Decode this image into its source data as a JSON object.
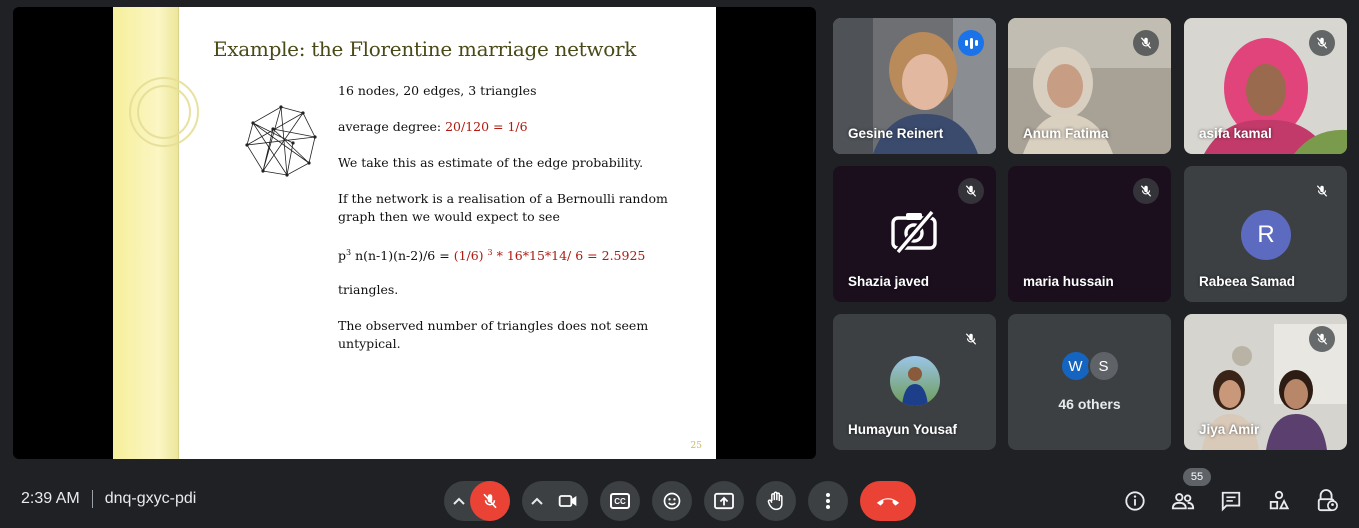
{
  "slide": {
    "title": "Example: the Florentine marriage network",
    "line1": "16 nodes, 20 edges, 3 triangles",
    "line2_prefix": "average degree: ",
    "line2_value": "20/120 = 1/6",
    "line3": "We take this as estimate of the edge probability.",
    "line4a": "If the network is a realisation of a Bernoulli random",
    "line4b": "graph then we would expect to see",
    "formula_base": "p",
    "formula_exp": "3",
    "formula_prefix": " n(n-1)(n-2)/6 = ",
    "formula_red_a": "(1/6) ",
    "formula_red_exp": "3",
    "formula_red_b": " * 16*15*14/ 6 = 2.5925",
    "line6": "triangles.",
    "line7a": "The observed number of triangles does not seem",
    "line7b": "untypical.",
    "page_number": "25"
  },
  "participants": [
    {
      "name": "Gesine Reinert",
      "state": "speaking"
    },
    {
      "name": "Anum Fatima",
      "state": "muted"
    },
    {
      "name": "asifa kamal",
      "state": "muted"
    },
    {
      "name": "Shazia javed",
      "state": "muted",
      "camera": "off"
    },
    {
      "name": "maria hussain",
      "state": "muted"
    },
    {
      "name": "Rabeea Samad",
      "state": "muted",
      "initial": "R"
    },
    {
      "name": "Humayun Yousaf",
      "state": "muted"
    },
    {
      "others_label": "46 others",
      "initials": [
        "W",
        "S"
      ]
    },
    {
      "name": "Jiya Amir",
      "state": "muted"
    }
  ],
  "meeting": {
    "time": "2:39 AM",
    "code": "dnq-gxyc-pdi",
    "people_count": "55"
  },
  "controls": {
    "cc_label": "CC"
  },
  "colors": {
    "background": "#202124",
    "tile": "#3c4043",
    "accent": "#8ab4f8",
    "end_call": "#ea4335",
    "speaking": "#1a73e8"
  }
}
